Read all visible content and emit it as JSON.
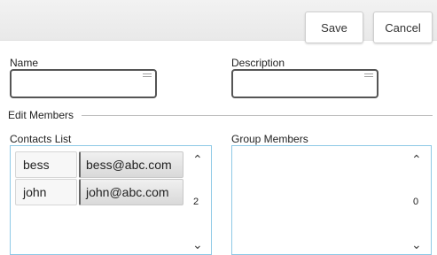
{
  "toolbar": {
    "save_label": "Save",
    "cancel_label": "Cancel"
  },
  "form": {
    "name_label": "Name",
    "name_value": "",
    "description_label": "Description",
    "description_value": ""
  },
  "edit_members": {
    "section_label": "Edit Members",
    "contacts_label": "Contacts List",
    "group_label": "Group Members",
    "contacts": [
      {
        "name": "bess",
        "email": "bess@abc.com"
      },
      {
        "name": "john",
        "email": "john@abc.com"
      }
    ],
    "contacts_count": "2",
    "group_count": "0"
  },
  "icons": {
    "text_field_icon": "lines-icon",
    "scroll_up": "chevron-up-icon",
    "scroll_down": "chevron-down-icon"
  },
  "colors": {
    "list_border": "#8ec9e6",
    "toolbar_bg": "#efefef"
  }
}
